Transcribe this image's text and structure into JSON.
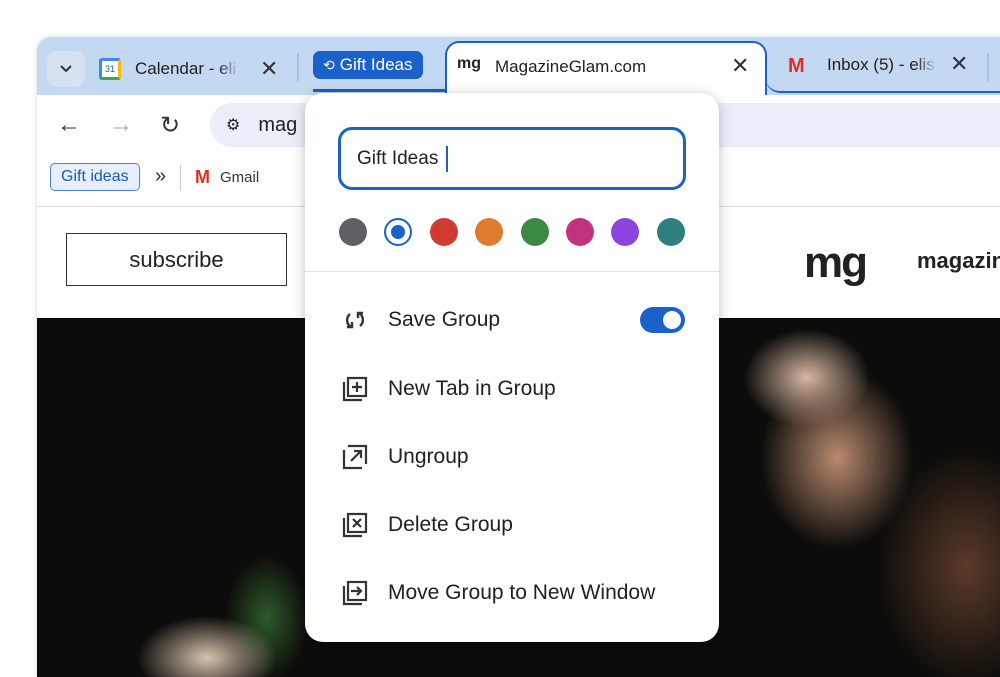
{
  "tabs": [
    {
      "title": "Calendar - eli",
      "icon": "google-calendar-icon",
      "icon_text": "31"
    },
    {
      "group_label": "Gift Ideas",
      "group_color": "#1a62c9"
    },
    {
      "title": "MagazineGlam.com",
      "icon": "magazineglam-favicon",
      "icon_text": "mg",
      "active": true
    },
    {
      "title": "Inbox (5) - elis",
      "icon": "gmail-icon"
    }
  ],
  "toolbar": {
    "url": "mag"
  },
  "bookmarks": {
    "group": "Gift ideas",
    "overflow": "»",
    "items": [
      {
        "label": "Gmail",
        "icon": "gmail-icon"
      }
    ]
  },
  "site": {
    "subscribe": "subscribe",
    "logo": "mg",
    "logo_text": "magazin"
  },
  "popup": {
    "name_value": "Gift Ideas",
    "colors": [
      "#5f6063",
      "#1a62c9",
      "#d23c30",
      "#e07b2d",
      "#3b8a44",
      "#c2337f",
      "#8b45dc",
      "#2f7f7f"
    ],
    "selected_color": "#1a62c9",
    "items": [
      {
        "label": "Save Group",
        "icon": "sync-icon",
        "toggle": true
      },
      {
        "label": "New Tab in Group",
        "icon": "add-tab-icon"
      },
      {
        "label": "Ungroup",
        "icon": "ungroup-icon"
      },
      {
        "label": "Delete Group",
        "icon": "delete-group-icon"
      },
      {
        "label": "Move Group to New Window",
        "icon": "move-window-icon"
      }
    ]
  }
}
